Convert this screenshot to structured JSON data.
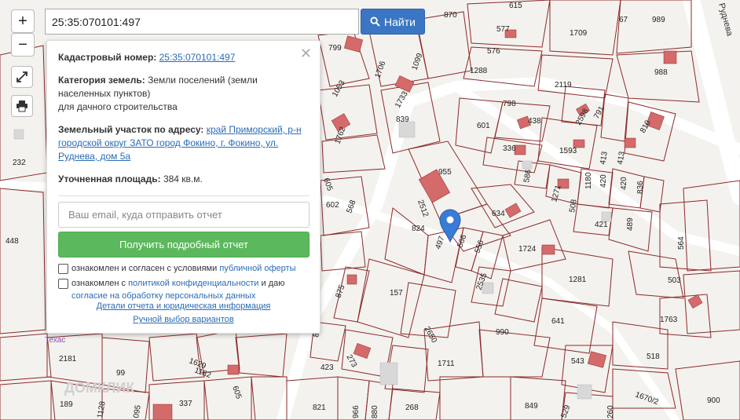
{
  "search": {
    "value": "25:35:070101:497",
    "button_label": "Найти"
  },
  "zoom": {
    "in_label": "+",
    "out_label": "−"
  },
  "popup": {
    "cadastral_label": "Кадастровый номер:",
    "cadastral_value": "25:35:070101:497",
    "category_label": "Категория земель:",
    "category_value": "Земли поселений (земли населенных пунктов)",
    "category_purpose": "для дачного строительства",
    "address_label": "Земельный участок по адресу:",
    "address_value": "край Приморский, р-н городской округ ЗАТО город Фокино, г. Фокино, ул. Руднева, дом 5а",
    "area_label": "Уточненная площадь:",
    "area_value": "384 кв.м.",
    "email_placeholder": "Ваш email, куда отправить отчет",
    "report_button": "Получить подробный отчет",
    "consent1_text": "ознакомлен и согласен с условиями ",
    "consent1_link": "публичной оферты",
    "consent2_text": "ознакомлен с ",
    "consent2_link1": "политикой конфиденциальности",
    "consent2_mid": " и даю ",
    "consent2_link2": "согласие на обработку персональных данных",
    "details_link": "Детали отчета и юридическая информация",
    "manual_link": "Ручной выбор вариантов"
  },
  "map": {
    "street_name": "Руднева",
    "place_label": "Техас",
    "watermark": "ДОМКЛИК",
    "plot_numbers": [
      "615",
      "870",
      "67",
      "989",
      "577",
      "1709",
      "576",
      "1288",
      "988",
      "799",
      "1706",
      "1099",
      "1053",
      "1733",
      "2119",
      "798",
      "2598",
      "601",
      "438",
      "791",
      "810",
      "839",
      "1762",
      "336",
      "1593",
      "413",
      "413",
      "232",
      "586",
      "955",
      "2512",
      "1271",
      "1180",
      "420",
      "420",
      "836",
      "508",
      "634",
      "605",
      "602",
      "568",
      "824",
      "497",
      "566",
      "556",
      "421",
      "489",
      "564",
      "448",
      "1724",
      "1281",
      "503",
      "2535",
      "875",
      "157",
      "1763",
      "990",
      "641",
      "2650",
      "806",
      "273",
      "1711",
      "423",
      "543",
      "518",
      "2181",
      "99",
      "1182",
      "1629",
      "605",
      "1128",
      "095",
      "337",
      "821",
      "966",
      "880",
      "268",
      "849",
      "529",
      "260",
      "1670/2",
      "189",
      "900"
    ],
    "colors": {
      "plot_line": "#8b2a2a",
      "building": "#d46a6a",
      "background": "#f4f2ee",
      "road": "#ffffff",
      "marker": "#3a7bd5"
    }
  }
}
